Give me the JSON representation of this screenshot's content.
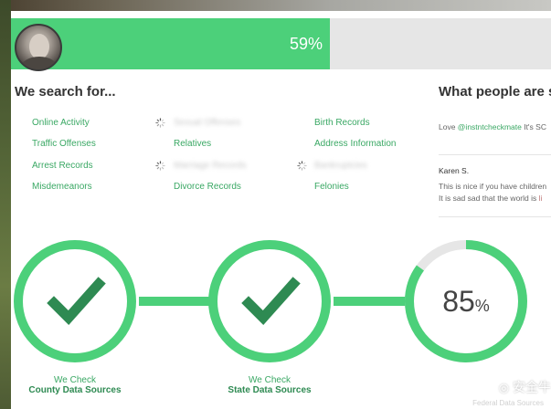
{
  "progress": {
    "percent": 59,
    "label": "59%"
  },
  "search": {
    "heading": "We search for...",
    "items": [
      {
        "label": "Online Activity",
        "blurred": false
      },
      {
        "label": "Traffic Offenses",
        "blurred": false
      },
      {
        "label": "Arrest Records",
        "blurred": false
      },
      {
        "label": "Misdemeanors",
        "blurred": false
      },
      {
        "label": "Sexual Offenses",
        "blurred": true
      },
      {
        "label": "Relatives",
        "blurred": false
      },
      {
        "label": "Marriage Records",
        "blurred": true
      },
      {
        "label": "Divorce Records",
        "blurred": false
      },
      {
        "label": "Birth Records",
        "blurred": false
      },
      {
        "label": "Address Information",
        "blurred": false
      },
      {
        "label": "Bankruptcies",
        "blurred": true
      },
      {
        "label": "Felonies",
        "blurred": false
      }
    ]
  },
  "testimonials": {
    "heading": "What people are sa",
    "first": {
      "prefix": "Love ",
      "handle": "@instntcheckmate",
      "suffix": " It's SC"
    },
    "second": {
      "name": "Karen S.",
      "line1": "This is nice if you have children",
      "line2_prefix": "It is sad sad that the world is ",
      "line2_link": "li"
    }
  },
  "steps": [
    {
      "line1": "We Check",
      "line2": "County Data Sources",
      "status": "done"
    },
    {
      "line1": "We Check",
      "line2": "State Data Sources",
      "status": "done"
    },
    {
      "percent_value": "85",
      "percent_sign": "%",
      "status": "in-progress",
      "progress": 0.85
    }
  ],
  "watermark": {
    "text": "安全牛",
    "sub": "Federal Data Sources"
  },
  "colors": {
    "accent": "#4cd07a",
    "accent_dark": "#2e8a52",
    "link": "#3aa864",
    "track": "#e6e6e6"
  }
}
